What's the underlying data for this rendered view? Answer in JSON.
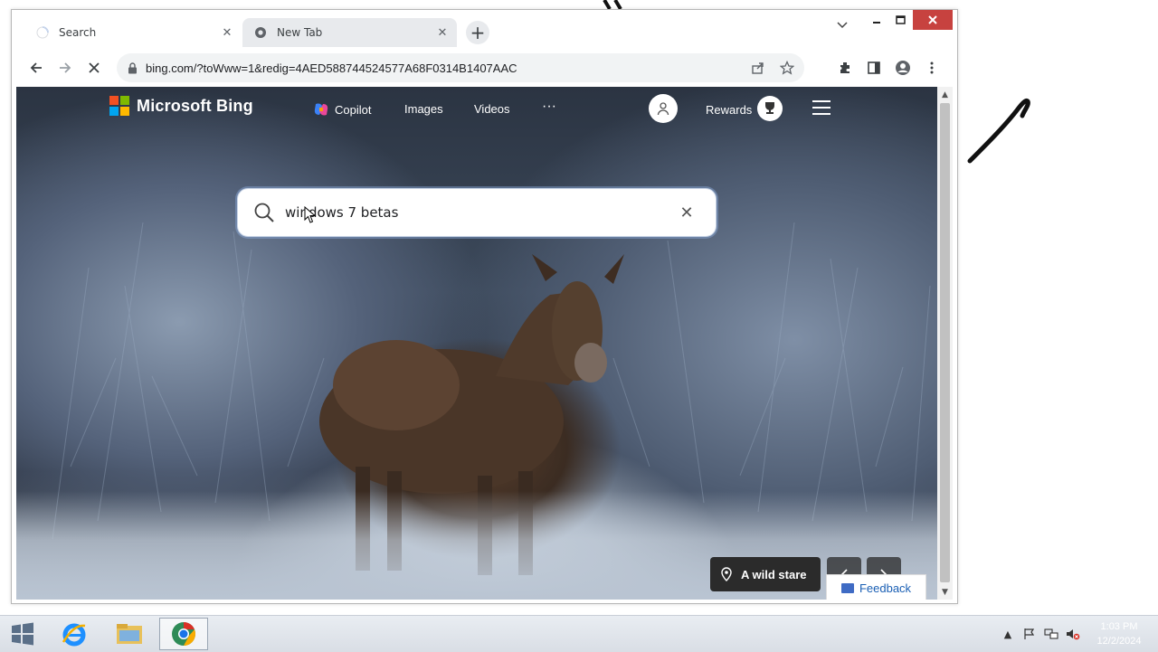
{
  "browser": {
    "tabs": [
      {
        "title": "Search",
        "state": "loading"
      },
      {
        "title": "New Tab",
        "state": "inactive"
      }
    ],
    "url": "bing.com/?toWww=1&redig=4AED588744524577A68F0314B1407AAC"
  },
  "bing": {
    "brand": "Microsoft Bing",
    "nav": {
      "copilot": "Copilot",
      "images": "Images",
      "videos": "Videos",
      "more": "···"
    },
    "rewards": "Rewards",
    "search_query": "windows 7 betas",
    "image_caption": "A wild stare",
    "feedback": "Feedback"
  },
  "taskbar": {
    "time": "1:03 PM",
    "date": "12/2/2024"
  },
  "colors": {
    "ms_red": "#f25022",
    "ms_green": "#7fba00",
    "ms_blue": "#00a4ef",
    "ms_yellow": "#ffb900",
    "close_red": "#c7423f"
  }
}
